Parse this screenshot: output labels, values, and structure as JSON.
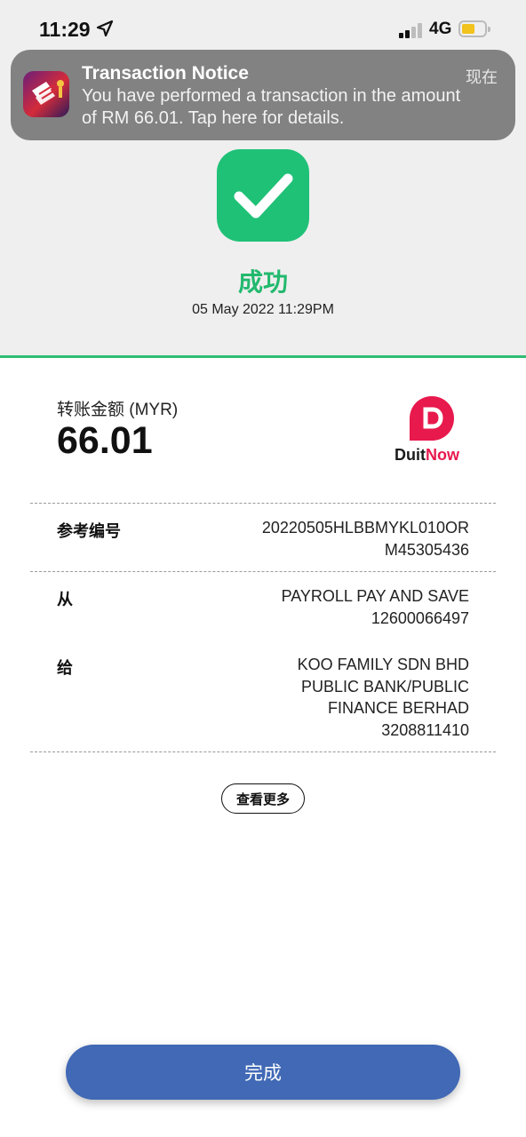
{
  "status_bar": {
    "time": "11:29",
    "network": "4G",
    "battery_level": 0.45,
    "signal_bars": 2
  },
  "notification": {
    "title": "Transaction Notice",
    "time": "现在",
    "body_line1": "You have performed a transaction in the amount",
    "body_line2": "of RM 66.01. Tap here for details."
  },
  "result": {
    "status": "成功",
    "datetime": "05 May 2022 11:29PM",
    "accent_color": "#1fc177"
  },
  "amount": {
    "label": "转账金额 (MYR)",
    "value": "66.01"
  },
  "brand": {
    "name_part1": "Duit",
    "name_part2": "Now",
    "color": "#e8194d"
  },
  "details": {
    "reference": {
      "label": "参考编号",
      "lines": [
        "20220505HLBBMYKL010OR",
        "M45305436"
      ]
    },
    "from": {
      "label": "从",
      "lines": [
        "PAYROLL PAY AND SAVE",
        "12600066497"
      ]
    },
    "to": {
      "label": "给",
      "lines": [
        "KOO FAMILY SDN BHD",
        "PUBLIC BANK/PUBLIC",
        "FINANCE BERHAD",
        "3208811410"
      ]
    }
  },
  "actions": {
    "more_label": "查看更多",
    "done_label": "完成",
    "done_color": "#4169b5"
  }
}
